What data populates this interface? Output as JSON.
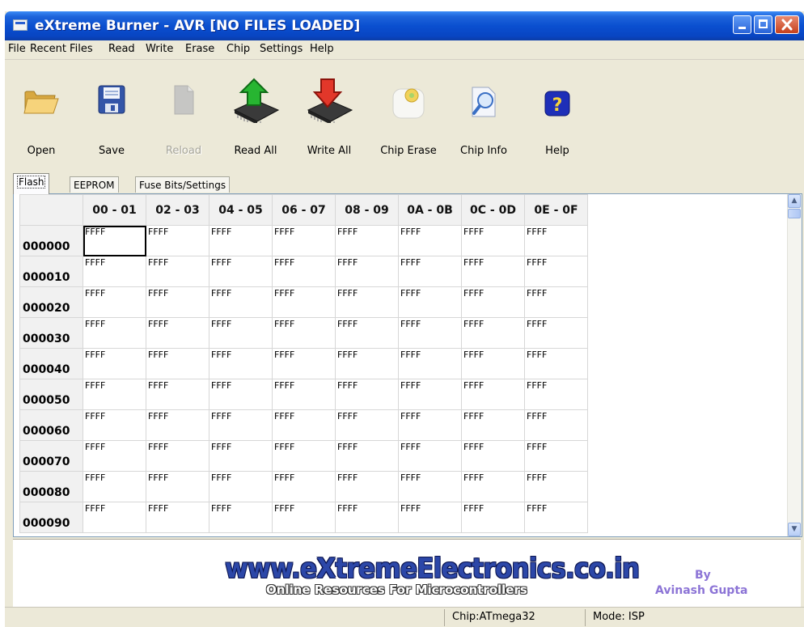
{
  "window": {
    "title": "eXtreme Burner - AVR [NO FILES LOADED]"
  },
  "menu": [
    "File",
    "Recent Files",
    "Read",
    "Write",
    "Erase",
    "Chip",
    "Settings",
    "Help"
  ],
  "toolbar": {
    "open_label": "Open",
    "save_label": "Save",
    "reload_label": "Reload",
    "read_all_label": "Read All",
    "write_all_label": "Write All",
    "chip_erase_label": "Chip Erase",
    "chip_info_label": "Chip Info",
    "help_label": "Help"
  },
  "tabs": [
    "Flash",
    "EEPROM",
    "Fuse Bits/Settings"
  ],
  "grid": {
    "columns": [
      "00 - 01",
      "02 - 03",
      "04 - 05",
      "06 - 07",
      "08 - 09",
      "0A - 0B",
      "0C - 0D",
      "0E - 0F"
    ],
    "rows": [
      {
        "address": "000000",
        "cells": [
          "FFFF",
          "FFFF",
          "FFFF",
          "FFFF",
          "FFFF",
          "FFFF",
          "FFFF",
          "FFFF"
        ]
      },
      {
        "address": "000010",
        "cells": [
          "FFFF",
          "FFFF",
          "FFFF",
          "FFFF",
          "FFFF",
          "FFFF",
          "FFFF",
          "FFFF"
        ]
      },
      {
        "address": "000020",
        "cells": [
          "FFFF",
          "FFFF",
          "FFFF",
          "FFFF",
          "FFFF",
          "FFFF",
          "FFFF",
          "FFFF"
        ]
      },
      {
        "address": "000030",
        "cells": [
          "FFFF",
          "FFFF",
          "FFFF",
          "FFFF",
          "FFFF",
          "FFFF",
          "FFFF",
          "FFFF"
        ]
      },
      {
        "address": "000040",
        "cells": [
          "FFFF",
          "FFFF",
          "FFFF",
          "FFFF",
          "FFFF",
          "FFFF",
          "FFFF",
          "FFFF"
        ]
      },
      {
        "address": "000050",
        "cells": [
          "FFFF",
          "FFFF",
          "FFFF",
          "FFFF",
          "FFFF",
          "FFFF",
          "FFFF",
          "FFFF"
        ]
      },
      {
        "address": "000060",
        "cells": [
          "FFFF",
          "FFFF",
          "FFFF",
          "FFFF",
          "FFFF",
          "FFFF",
          "FFFF",
          "FFFF"
        ]
      },
      {
        "address": "000070",
        "cells": [
          "FFFF",
          "FFFF",
          "FFFF",
          "FFFF",
          "FFFF",
          "FFFF",
          "FFFF",
          "FFFF"
        ]
      },
      {
        "address": "000080",
        "cells": [
          "FFFF",
          "FFFF",
          "FFFF",
          "FFFF",
          "FFFF",
          "FFFF",
          "FFFF",
          "FFFF"
        ]
      },
      {
        "address": "000090",
        "cells": [
          "FFFF",
          "FFFF",
          "FFFF",
          "FFFF",
          "FFFF",
          "FFFF",
          "FFFF",
          "FFFF"
        ]
      }
    ]
  },
  "footer": {
    "logo_text": "www.eXtremeElectronics.co.in",
    "logo_tagline": "Online Resources For Microcontrollers",
    "by": "By",
    "author": "Avinash Gupta"
  },
  "status": {
    "chip": "Chip:ATmega32",
    "mode": "Mode: ISP"
  },
  "colors": {
    "titlebar": "#0A4FD0",
    "window_bg": "#ECE9D8",
    "logo_blue": "#2c47a8",
    "author_purple": "#8c74d6"
  },
  "icons": [
    "folder-icon",
    "floppy-disk-icon",
    "document-icon",
    "chip-upload-icon",
    "chip-download-icon",
    "eraser-icon",
    "magnifier-icon",
    "help-icon"
  ]
}
